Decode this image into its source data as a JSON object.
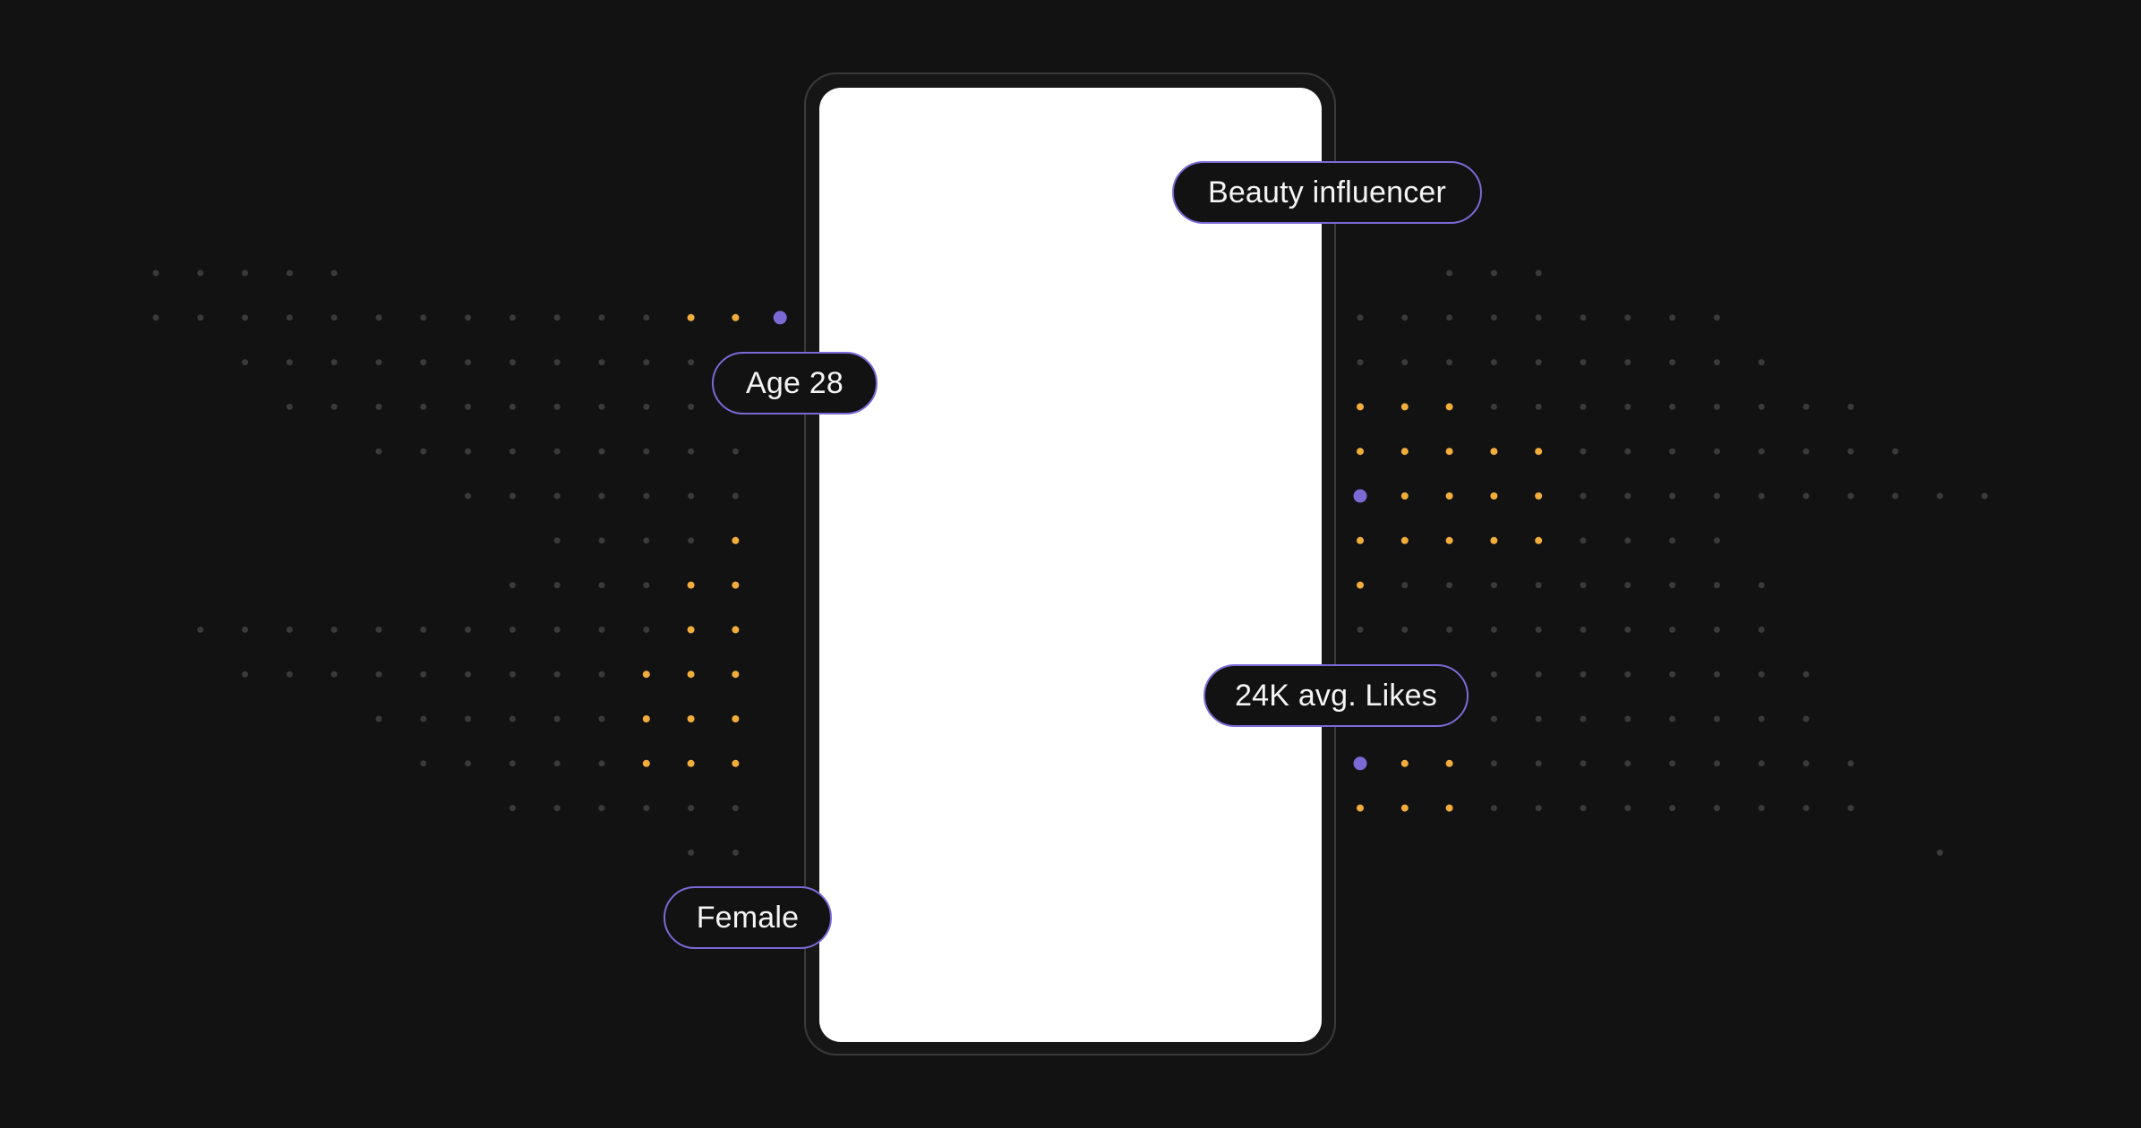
{
  "tags": {
    "interest": "Beauty influencer",
    "age": "Age 28",
    "engagement": "24K avg. Likes",
    "gender": "Female"
  },
  "colors": {
    "background": "#121212",
    "dot_muted": "#3a3a3a",
    "dot_highlight": "#f2ad3b",
    "accent_purple": "#7b6ad6",
    "screen": "#ffffff",
    "tag_text": "#f4f4f4"
  },
  "icons": [
    "map-dot",
    "purple-anchor-dot"
  ]
}
